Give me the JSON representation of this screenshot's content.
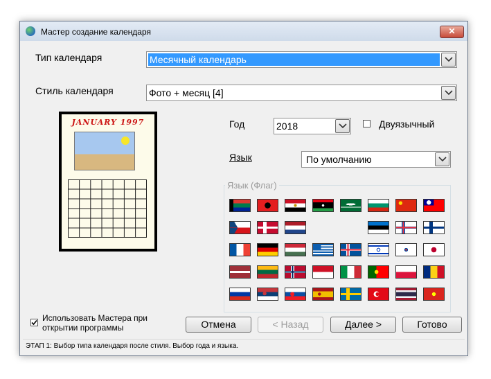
{
  "window": {
    "title": "Мастер создание календаря",
    "close_label": "✕"
  },
  "fields": {
    "calendar_type": {
      "label": "Тип календаря",
      "value": "Месячный календарь"
    },
    "calendar_style": {
      "label": "Стиль календаря",
      "value": "Фото + месяц [4]"
    },
    "year": {
      "label": "Год",
      "value": "2018"
    },
    "bilingual": {
      "label": "Двуязычный",
      "checked": false
    },
    "language": {
      "label": "Язык",
      "value": "По умолчанию"
    }
  },
  "preview": {
    "title": "JANUARY 1997"
  },
  "language_flag_group": {
    "label": "Язык (Флаг)",
    "flags": [
      "south-africa",
      "albania",
      "egypt",
      "libya",
      "saudi-arabia",
      "bulgaria",
      "china",
      "taiwan",
      "czech",
      "denmark",
      "netherlands",
      "",
      "",
      "estonia",
      "faroe-islands",
      "finland",
      "france",
      "germany",
      "hungary",
      "greece",
      "iceland",
      "israel",
      "south-korea",
      "japan",
      "latvia",
      "lithuania",
      "norway",
      "indonesia",
      "italy",
      "portugal",
      "poland",
      "romania",
      "russia",
      "serbia",
      "slovakia",
      "spain",
      "sweden",
      "turkey",
      "thailand",
      "vietnam"
    ]
  },
  "startup_checkbox": {
    "label_line1": "Использовать Мастера при",
    "label_line2": "открытии программы",
    "checked": true
  },
  "buttons": {
    "cancel": "Отмена",
    "back": "< Назад",
    "next": "Далее >",
    "finish": "Готово"
  },
  "status": "ЭТАП 1: Выбор типа календаря после стиля. Выбор года и языка."
}
